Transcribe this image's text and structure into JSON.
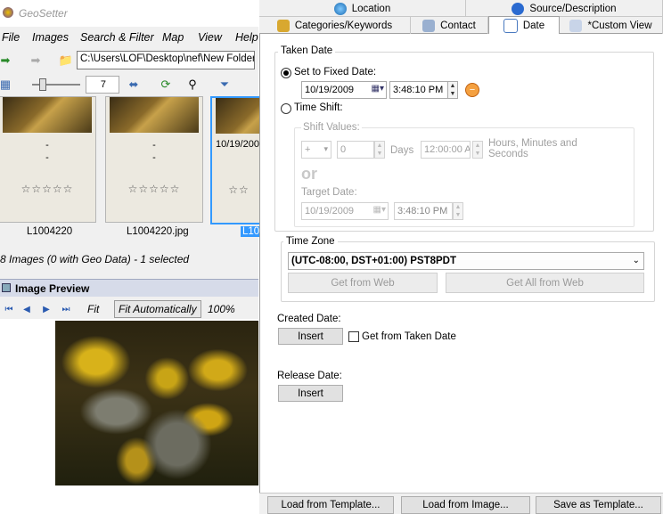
{
  "left": {
    "app_title": "GeoSetter",
    "menu": [
      "File",
      "Images",
      "Search & Filter",
      "Map",
      "View",
      "Help"
    ],
    "address": "C:\\Users\\LOF\\Desktop\\nef\\New Folder",
    "zoom_value": "7",
    "thumbs": [
      {
        "dash1": "-",
        "dash2": "-",
        "stars": "☆☆☆☆☆",
        "name": "L1004220"
      },
      {
        "dash1": "-",
        "dash2": "-",
        "stars": "☆☆☆☆☆",
        "name": "L1004220.jpg"
      },
      {
        "dash1": "10/19/200",
        "dash2": "",
        "stars": "☆☆",
        "name": "L10"
      }
    ],
    "status": "8 Images (0 with Geo Data) - 1 selected",
    "preview_title": "Image Preview",
    "fit_label": "Fit",
    "fit_auto_label": "Fit Automatically",
    "zoom_percent": "100%"
  },
  "right": {
    "tabs_row1": [
      "Location",
      "Source/Description"
    ],
    "tabs_row2": [
      "Categories/Keywords",
      "Contact",
      "Date",
      "*Custom View"
    ],
    "taken_date": {
      "group_label": "Taken Date",
      "fixed_label": "Set to Fixed Date:",
      "fixed_date": "10/19/2009",
      "fixed_time": "3:48:10 PM",
      "shift_label": "Time Shift:",
      "shift_values_label": "Shift Values:",
      "sign": "+",
      "days_value": "0",
      "days_label": "Days",
      "time_value": "12:00:00 A",
      "hms_label": "Hours, Minutes and Seconds",
      "or_label": "or",
      "target_label": "Target Date:",
      "target_date": "10/19/2009",
      "target_time": "3:48:10 PM"
    },
    "time_zone": {
      "group_label": "Time Zone",
      "value": "(UTC-08:00, DST+01:00) PST8PDT",
      "get_web": "Get from Web",
      "get_all_web": "Get All from Web"
    },
    "created": {
      "label": "Created Date:",
      "insert": "Insert",
      "get_taken": "Get from Taken Date"
    },
    "release": {
      "label": "Release Date:",
      "insert": "Insert"
    },
    "bottom": {
      "load_template": "Load from Template...",
      "load_image": "Load from Image...",
      "save_template": "Save as Template..."
    }
  },
  "colors": {
    "accent_selection": "#3399ff",
    "tab_bg": "#f0f0f0"
  }
}
